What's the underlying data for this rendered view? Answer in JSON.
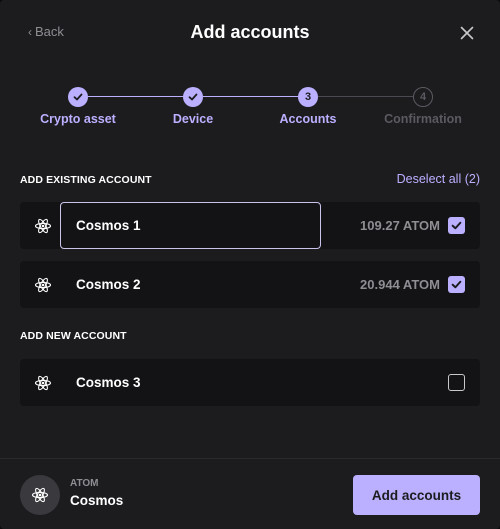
{
  "header": {
    "back_label": "Back",
    "title": "Add accounts"
  },
  "stepper": {
    "steps": [
      {
        "label": "Crypto asset",
        "state": "done",
        "marker": "✓"
      },
      {
        "label": "Device",
        "state": "done",
        "marker": "✓"
      },
      {
        "label": "Accounts",
        "state": "active",
        "marker": "3"
      },
      {
        "label": "Confirmation",
        "state": "pending",
        "marker": "4"
      }
    ]
  },
  "existing": {
    "section_label": "ADD EXISTING ACCOUNT",
    "deselect_label": "Deselect all (2)",
    "accounts": [
      {
        "name": "Cosmos 1",
        "balance": "109.27 ATOM",
        "checked": true,
        "editing": true
      },
      {
        "name": "Cosmos 2",
        "balance": "20.944 ATOM",
        "checked": true,
        "editing": false
      }
    ]
  },
  "new_accounts": {
    "section_label": "ADD NEW ACCOUNT",
    "accounts": [
      {
        "name": "Cosmos 3",
        "balance": "",
        "checked": false
      }
    ]
  },
  "footer": {
    "ticker": "ATOM",
    "currency_name": "Cosmos",
    "add_button_label": "Add accounts"
  },
  "colors": {
    "accent": "#bbb0ff",
    "background": "#1c1c1f",
    "row_background": "#131315",
    "muted_text": "#8e8e93"
  },
  "icons": {
    "back": "chevron-left-icon",
    "close": "close-icon",
    "coin": "cosmos-atom-icon",
    "check": "checkmark-icon"
  }
}
